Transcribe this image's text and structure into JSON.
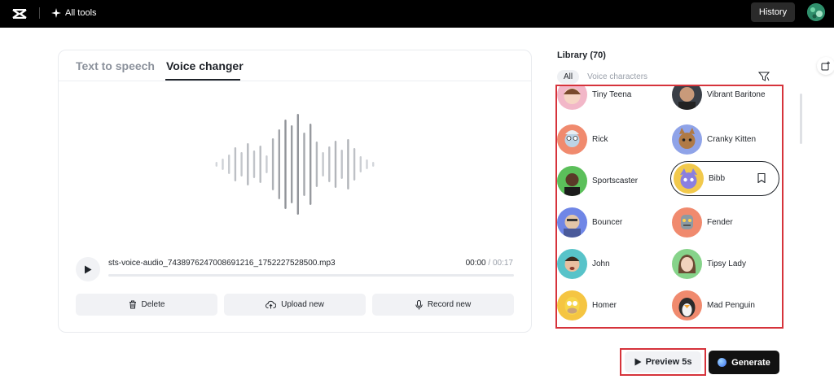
{
  "topbar": {
    "all_tools_label": "All tools",
    "history_label": "History"
  },
  "tabs": {
    "text_to_speech": "Text to speech",
    "voice_changer": "Voice changer"
  },
  "audio": {
    "filename": "sts-voice-audio_7438976247008691216_1752227528500.mp3",
    "current_time": "00:00",
    "separator": " / ",
    "total_time": "00:17",
    "progress": 0
  },
  "actions": {
    "delete_label": "Delete",
    "upload_label": "Upload new",
    "record_label": "Record new"
  },
  "library": {
    "title": "Library (70)",
    "tab_all": "All",
    "tab_voice_characters": "Voice characters",
    "voices": [
      {
        "name": "Tiny Teena",
        "color": "#f2b7c8"
      },
      {
        "name": "Vibrant Baritone",
        "color": "#3a3f47"
      },
      {
        "name": "Rick",
        "color": "#f08a6e"
      },
      {
        "name": "Cranky Kitten",
        "color": "#8fa3e8"
      },
      {
        "name": "Sportscaster",
        "color": "#5bbf5a"
      },
      {
        "name": "Bibb",
        "color": "#f2c94c"
      },
      {
        "name": "Bouncer",
        "color": "#6f86e6"
      },
      {
        "name": "Fender",
        "color": "#f08a6e"
      },
      {
        "name": "John",
        "color": "#58c3c9"
      },
      {
        "name": "Tipsy Lady",
        "color": "#86d38a"
      },
      {
        "name": "Homer",
        "color": "#f5c542"
      },
      {
        "name": "Mad Penguin",
        "color": "#f08a6e"
      }
    ]
  },
  "footer": {
    "preview_label": "Preview 5s",
    "generate_label": "Generate"
  },
  "colors": {
    "accent_dark": "#111111",
    "highlight_red": "#d6333b"
  }
}
